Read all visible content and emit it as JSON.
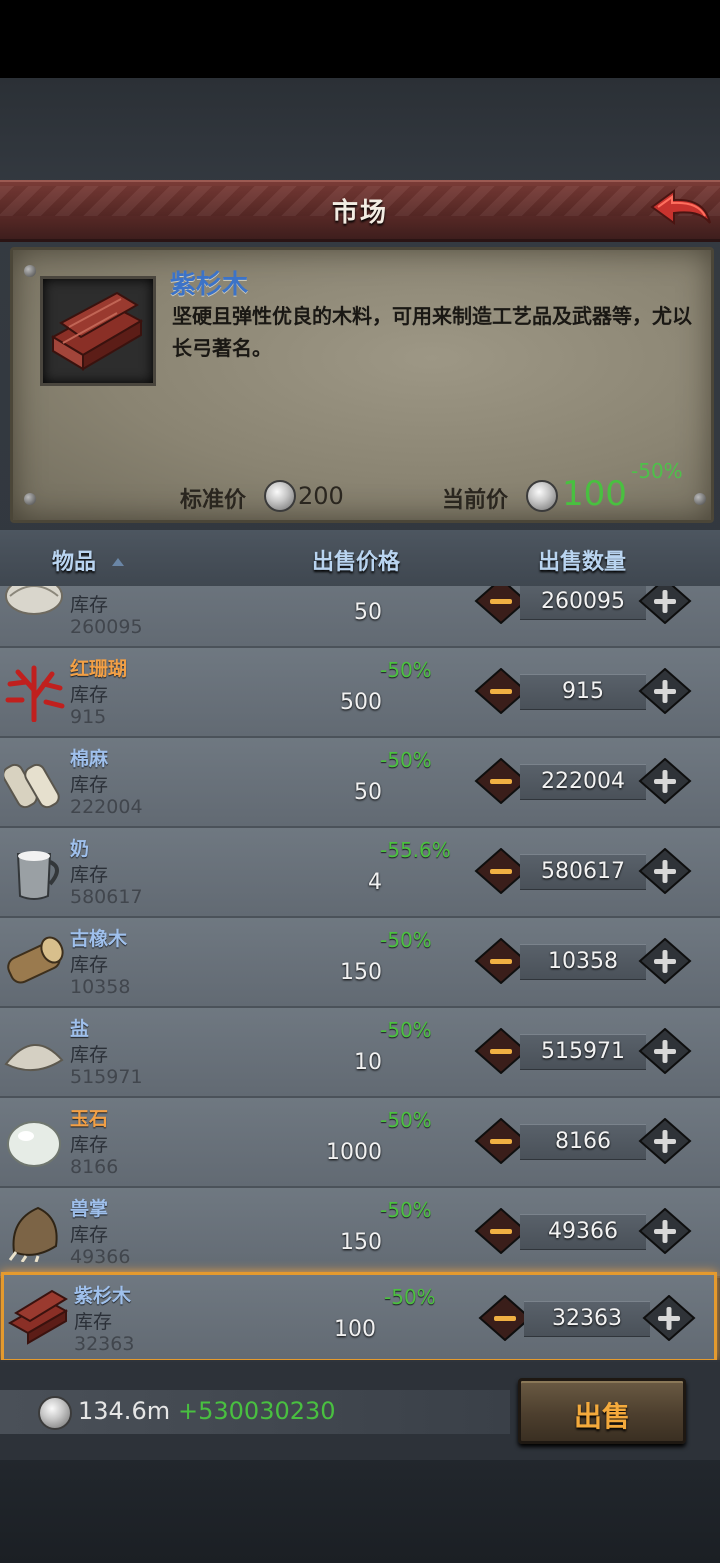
{
  "header": {
    "title": "市场"
  },
  "info": {
    "name": "紫杉木",
    "description": "坚硬且弹性优良的木料，可用来制造工艺品及武器等，尤以长弓著名。",
    "standard_label": "标准价",
    "standard_price": "200",
    "current_label": "当前价",
    "current_price": "100",
    "discount": "-50%"
  },
  "table": {
    "headers": {
      "item": "物品",
      "price": "出售价格",
      "qty": "出售数量"
    },
    "stock_label": "库存",
    "rows": [
      {
        "name": "",
        "icon": "oyster-icon",
        "stock": "260095",
        "price": "50",
        "discount": "",
        "qty": "260095",
        "name_color": "blue"
      },
      {
        "name": "红珊瑚",
        "icon": "red-coral-icon",
        "stock": "915",
        "price": "500",
        "discount": "-50%",
        "qty": "915",
        "name_color": "orange"
      },
      {
        "name": "棉麻",
        "icon": "linen-roll-icon",
        "stock": "222004",
        "price": "50",
        "discount": "-50%",
        "qty": "222004",
        "name_color": "blue"
      },
      {
        "name": "奶",
        "icon": "milk-jug-icon",
        "stock": "580617",
        "price": "4",
        "discount": "-55.6%",
        "qty": "580617",
        "name_color": "blue"
      },
      {
        "name": "古橡木",
        "icon": "oak-log-icon",
        "stock": "10358",
        "price": "150",
        "discount": "-50%",
        "qty": "10358",
        "name_color": "blue"
      },
      {
        "name": "盐",
        "icon": "salt-pile-icon",
        "stock": "515971",
        "price": "10",
        "discount": "-50%",
        "qty": "515971",
        "name_color": "blue"
      },
      {
        "name": "玉石",
        "icon": "jade-stone-icon",
        "stock": "8166",
        "price": "1000",
        "discount": "-50%",
        "qty": "8166",
        "name_color": "orange"
      },
      {
        "name": "兽掌",
        "icon": "beast-paw-icon",
        "stock": "49366",
        "price": "150",
        "discount": "-50%",
        "qty": "49366",
        "name_color": "blue"
      },
      {
        "name": "紫杉木",
        "icon": "yew-wood-icon",
        "stock": "32363",
        "price": "100",
        "discount": "-50%",
        "qty": "32363",
        "name_color": "blue",
        "selected": true
      }
    ]
  },
  "footer": {
    "money": "134.6m",
    "gain": "+530030230",
    "sell_label": "出售"
  },
  "colors": {
    "accent_green": "#49c040",
    "name_blue": "#9fc0ec",
    "name_orange": "#f2a046",
    "selected_border": "#e49a2e"
  }
}
